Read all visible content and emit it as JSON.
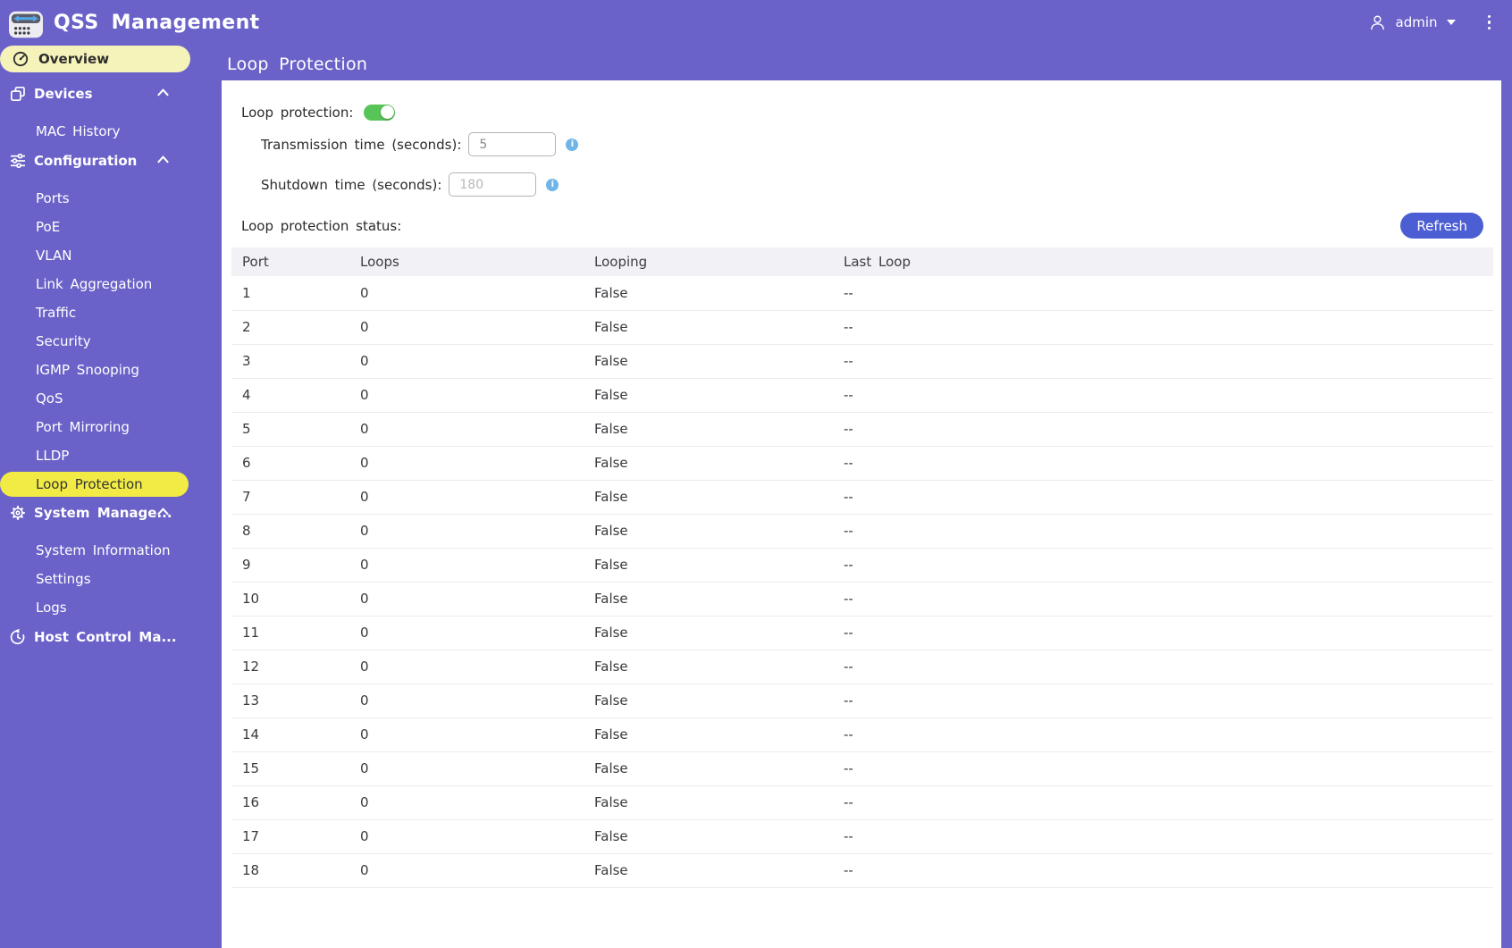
{
  "header": {
    "app_title": "QSS Management",
    "user": "admin",
    "logo_icon": "switch-logo-icon",
    "user_icon": "person-icon",
    "menu_icon": "kebab-menu-icon"
  },
  "sidebar": {
    "items": [
      {
        "label": "Overview",
        "type": "top",
        "icon": "gauge-icon",
        "active": true
      },
      {
        "label": "Devices",
        "type": "group",
        "icon": "devices-icon",
        "chevron": "up"
      },
      {
        "label": "MAC History",
        "type": "sub"
      },
      {
        "label": "Configuration",
        "type": "group",
        "icon": "sliders-icon",
        "chevron": "up"
      },
      {
        "label": "Ports",
        "type": "sub"
      },
      {
        "label": "PoE",
        "type": "sub"
      },
      {
        "label": "VLAN",
        "type": "sub"
      },
      {
        "label": "Link Aggregation",
        "type": "sub"
      },
      {
        "label": "Traffic",
        "type": "sub"
      },
      {
        "label": "Security",
        "type": "sub"
      },
      {
        "label": "IGMP Snooping",
        "type": "sub"
      },
      {
        "label": "QoS",
        "type": "sub"
      },
      {
        "label": "Port Mirroring",
        "type": "sub"
      },
      {
        "label": "LLDP",
        "type": "sub"
      },
      {
        "label": "Loop Protection",
        "type": "sub",
        "highlighted": true
      },
      {
        "label": "System Manage...",
        "type": "group",
        "icon": "gear-icon",
        "chevron": "up"
      },
      {
        "label": "System Information",
        "type": "sub"
      },
      {
        "label": "Settings",
        "type": "sub"
      },
      {
        "label": "Logs",
        "type": "sub"
      },
      {
        "label": "Host Control Ma...",
        "type": "group",
        "icon": "history-icon"
      }
    ]
  },
  "main": {
    "page_title": "Loop Protection",
    "form": {
      "loop_protection_label": "Loop protection:",
      "loop_protection_enabled": true,
      "transmission_label": "Transmission time (seconds):",
      "transmission_value": "5",
      "shutdown_label": "Shutdown time (seconds):",
      "shutdown_value": "180",
      "status_label": "Loop protection status:"
    },
    "toolbar": {
      "refresh_label": "Refresh"
    },
    "table": {
      "columns": [
        "Port",
        "Loops",
        "Looping",
        "Last Loop"
      ],
      "rows": [
        [
          "1",
          "0",
          "False",
          "--"
        ],
        [
          "2",
          "0",
          "False",
          "--"
        ],
        [
          "3",
          "0",
          "False",
          "--"
        ],
        [
          "4",
          "0",
          "False",
          "--"
        ],
        [
          "5",
          "0",
          "False",
          "--"
        ],
        [
          "6",
          "0",
          "False",
          "--"
        ],
        [
          "7",
          "0",
          "False",
          "--"
        ],
        [
          "8",
          "0",
          "False",
          "--"
        ],
        [
          "9",
          "0",
          "False",
          "--"
        ],
        [
          "10",
          "0",
          "False",
          "--"
        ],
        [
          "11",
          "0",
          "False",
          "--"
        ],
        [
          "12",
          "0",
          "False",
          "--"
        ],
        [
          "13",
          "0",
          "False",
          "--"
        ],
        [
          "14",
          "0",
          "False",
          "--"
        ],
        [
          "15",
          "0",
          "False",
          "--"
        ],
        [
          "16",
          "0",
          "False",
          "--"
        ],
        [
          "17",
          "0",
          "False",
          "--"
        ],
        [
          "18",
          "0",
          "False",
          "--"
        ]
      ]
    }
  },
  "icons": {
    "info_glyph": "i"
  },
  "colors": {
    "purple": "#6a62c8",
    "pale-yellow": "#f6f3ba",
    "bright-yellow": "#f2eb45",
    "button-blue": "#4c5ed4",
    "toggle-green": "#57c457",
    "info-blue": "#6fb5e8",
    "table-header-bg": "#f1f1f6"
  }
}
